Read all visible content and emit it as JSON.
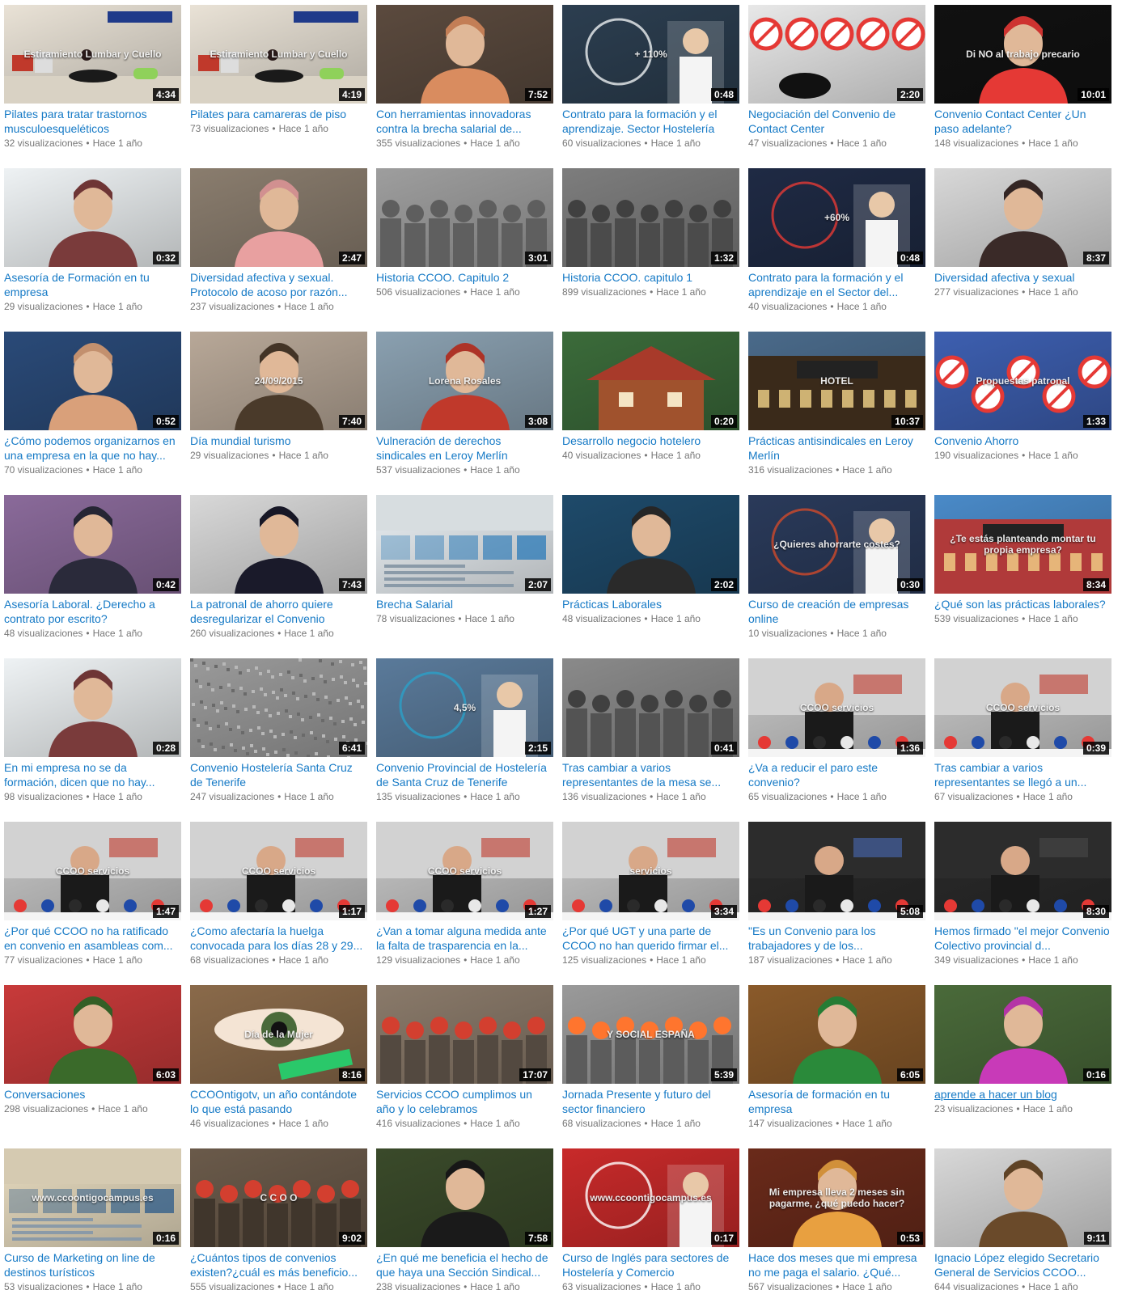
{
  "videos": [
    {
      "title": "Pilates para tratar trastornos musculoesqueléticos",
      "views": "32 visualizaciones",
      "age": "Hace 1 año",
      "duration": "4:34",
      "overlay": "Estiramiento Lumbar y Cuello",
      "bg": "#e9e2d6",
      "accent": "#c0392b",
      "kind": "pilates"
    },
    {
      "title": "Pilates para camareras de piso",
      "views": "73 visualizaciones",
      "age": "Hace 1 año",
      "duration": "4:19",
      "overlay": "Estiramiento Lumbar y Cuello",
      "bg": "#e9e2d6",
      "accent": "#c0392b",
      "kind": "pilates"
    },
    {
      "title": "Con herramientas innovadoras contra la brecha salarial de...",
      "views": "355 visualizaciones",
      "age": "Hace 1 año",
      "duration": "7:52",
      "overlay": "",
      "bg": "#5b4a3e",
      "accent": "#d98c5f",
      "kind": "person"
    },
    {
      "title": "Contrato para la formación y el aprendizaje. Sector Hostelería",
      "views": "60 visualizaciones",
      "age": "Hace 1 año",
      "duration": "0:48",
      "overlay": "+ 110%",
      "bg": "#2c3e50",
      "accent": "#ecf0f1",
      "kind": "badge"
    },
    {
      "title": "Negociación del Convenio de Contact Center",
      "views": "47 visualizaciones",
      "age": "Hace 1 año",
      "duration": "2:20",
      "overlay": "",
      "bg": "#e8e8e8",
      "accent": "#e53935",
      "kind": "signs"
    },
    {
      "title": "Convenio Contact Center ¿Un paso adelante?",
      "views": "148 visualizaciones",
      "age": "Hace 1 año",
      "duration": "10:01",
      "overlay": "Di NO al trabajo precario",
      "bg": "#111111",
      "accent": "#e53935",
      "kind": "person"
    },
    {
      "title": "Asesoría de Formación en tu empresa",
      "views": "29 visualizaciones",
      "age": "Hace 1 año",
      "duration": "0:32",
      "overlay": "",
      "bg": "#eef2f4",
      "accent": "#7a3b3b",
      "kind": "person"
    },
    {
      "title": "Diversidad afectiva y sexual. Protocolo de acoso por razón...",
      "views": "237 visualizaciones",
      "age": "Hace 1 año",
      "duration": "2:47",
      "overlay": "",
      "bg": "#8a7d6e",
      "accent": "#e8a0a0",
      "kind": "person"
    },
    {
      "title": "Historia CCOO. Capitulo 2",
      "views": "506 visualizaciones",
      "age": "Hace 1 año",
      "duration": "3:01",
      "overlay": "",
      "bg": "#9e9e9e",
      "accent": "#555555",
      "kind": "crowd"
    },
    {
      "title": "Historia CCOO. capitulo 1",
      "views": "899 visualizaciones",
      "age": "Hace 1 año",
      "duration": "1:32",
      "overlay": "",
      "bg": "#7d7d7d",
      "accent": "#3a3a3a",
      "kind": "crowd"
    },
    {
      "title": "Contrato para la formación y el aprendizaje en el Sector del...",
      "views": "40 visualizaciones",
      "age": "Hace 1 año",
      "duration": "0:48",
      "overlay": "+60%",
      "bg": "#1f2a44",
      "accent": "#e53935",
      "kind": "badge"
    },
    {
      "title": "Diversidad afectiva y sexual",
      "views": "277 visualizaciones",
      "age": "Hace 1 año",
      "duration": "8:37",
      "overlay": "",
      "bg": "#d8d8d8",
      "accent": "#3a2a28",
      "kind": "person"
    },
    {
      "title": "¿Cómo podemos organizarnos en una empresa en la que no hay...",
      "views": "70 visualizaciones",
      "age": "Hace 1 año",
      "duration": "0:52",
      "overlay": "",
      "bg": "#2a4a78",
      "accent": "#d9a07a",
      "kind": "person"
    },
    {
      "title": "Día mundial turismo",
      "views": "29 visualizaciones",
      "age": "Hace 1 año",
      "duration": "7:40",
      "overlay": "24/09/2015",
      "bg": "#b8a898",
      "accent": "#4a3a2a",
      "kind": "person"
    },
    {
      "title": "Vulneración de derechos sindicales en Leroy Merlín",
      "views": "537 visualizaciones",
      "age": "Hace 1 año",
      "duration": "3:08",
      "overlay": "Lorena Rosales",
      "bg": "#8aa0b0",
      "accent": "#c0392b",
      "kind": "person"
    },
    {
      "title": "Desarrollo negocio hotelero",
      "views": "40 visualizaciones",
      "age": "Hace 1 año",
      "duration": "0:20",
      "overlay": "",
      "bg": "#3b6b3a",
      "accent": "#a0522d",
      "kind": "house"
    },
    {
      "title": "Prácticas antisindicales en Leroy Merlín",
      "views": "316 visualizaciones",
      "age": "Hace 1 año",
      "duration": "10:37",
      "overlay": "HOTEL",
      "bg": "#4a6a8a",
      "accent": "#3a2a1a",
      "kind": "hotel"
    },
    {
      "title": "Convenio Ahorro",
      "views": "190 visualizaciones",
      "age": "Hace 1 año",
      "duration": "1:33",
      "overlay": "Propuestas patronal",
      "bg": "#3d5fb0",
      "accent": "#e53935",
      "kind": "signs"
    },
    {
      "title": "Asesoría Laboral. ¿Derecho a contrato por escrito?",
      "views": "48 visualizaciones",
      "age": "Hace 1 año",
      "duration": "0:42",
      "overlay": "",
      "bg": "#8a6a9a",
      "accent": "#2a2a3a",
      "kind": "person"
    },
    {
      "title": "La patronal de ahorro quiere desregularizar el Convenio",
      "views": "260 visualizaciones",
      "age": "Hace 1 año",
      "duration": "7:43",
      "overlay": "",
      "bg": "#d8d8d8",
      "accent": "#1a1a2a",
      "kind": "person"
    },
    {
      "title": "Brecha Salarial",
      "views": "78 visualizaciones",
      "age": "Hace 1 año",
      "duration": "2:07",
      "overlay": "",
      "bg": "#eaf0f4",
      "accent": "#2a7ab8",
      "kind": "web"
    },
    {
      "title": "Prácticas Laborales",
      "views": "48 visualizaciones",
      "age": "Hace 1 año",
      "duration": "2:02",
      "overlay": "",
      "bg": "#1e4a6a",
      "accent": "#2a2a2a",
      "kind": "person"
    },
    {
      "title": "Curso de creación de empresas online",
      "views": "10 visualizaciones",
      "age": "Hace 1 año",
      "duration": "0:30",
      "overlay": "¿Quieres ahorrarte costes?",
      "bg": "#2a3a5a",
      "accent": "#d04a2a",
      "kind": "badge"
    },
    {
      "title": "¿Qué son las prácticas laborales?",
      "views": "539 visualizaciones",
      "age": "Hace 1 año",
      "duration": "8:34",
      "overlay": "¿Te estás planteando montar tu propia empresa?",
      "bg": "#4a8ac8",
      "accent": "#b03a3a",
      "kind": "hotel"
    },
    {
      "title": "En mi empresa no se da formación, dicen que no hay...",
      "views": "98 visualizaciones",
      "age": "Hace 1 año",
      "duration": "0:28",
      "overlay": "",
      "bg": "#eef2f4",
      "accent": "#7a3b3b",
      "kind": "person"
    },
    {
      "title": "Convenio Hostelería Santa Cruz de Tenerife",
      "views": "247 visualizaciones",
      "age": "Hace 1 año",
      "duration": "6:41",
      "overlay": "",
      "bg": "#9a9a9a",
      "accent": "#7a7a7a",
      "kind": "noise"
    },
    {
      "title": "Convenio Provincial de Hostelería de Santa Cruz de Tenerife",
      "views": "135 visualizaciones",
      "age": "Hace 1 año",
      "duration": "2:15",
      "overlay": "4,5%",
      "bg": "#5a7a9a",
      "accent": "#2aa0c8",
      "kind": "badge"
    },
    {
      "title": "Tras cambiar a varios representantes de la mesa se...",
      "views": "136 visualizaciones",
      "age": "Hace 1 año",
      "duration": "0:41",
      "overlay": "",
      "bg": "#8a8a8a",
      "accent": "#3a3a3a",
      "kind": "crowd"
    },
    {
      "title": "¿Va a reducir el paro este convenio?",
      "views": "65 visualizaciones",
      "age": "Hace 1 año",
      "duration": "1:36",
      "overlay": "CCOO servicios",
      "bg": "#c8c8c8",
      "accent": "#c0392b",
      "kind": "press"
    },
    {
      "title": "Tras cambiar a varios representantes se llegó a un...",
      "views": "67 visualizaciones",
      "age": "Hace 1 año",
      "duration": "0:39",
      "overlay": "CCOO servicios",
      "bg": "#c8c8c8",
      "accent": "#c0392b",
      "kind": "press"
    },
    {
      "title": "¿Por qué CCOO no ha ratificado en convenio en asambleas com...",
      "views": "77 visualizaciones",
      "age": "Hace 1 año",
      "duration": "1:47",
      "overlay": "CCOO servicios",
      "bg": "#c8c8c8",
      "accent": "#c0392b",
      "kind": "press"
    },
    {
      "title": "¿Como afectaría la huelga convocada para los días 28 y 29...",
      "views": "68 visualizaciones",
      "age": "Hace 1 año",
      "duration": "1:17",
      "overlay": "CCOO servicios",
      "bg": "#c8c8c8",
      "accent": "#c0392b",
      "kind": "press"
    },
    {
      "title": "¿Van a tomar alguna medida ante la falta de trasparencia en la...",
      "views": "129 visualizaciones",
      "age": "Hace 1 año",
      "duration": "1:27",
      "overlay": "CCOO servicios",
      "bg": "#c8c8c8",
      "accent": "#c0392b",
      "kind": "press"
    },
    {
      "title": "¿Por qué UGT y una parte de CCOO no han querido firmar el...",
      "views": "125 visualizaciones",
      "age": "Hace 1 año",
      "duration": "3:34",
      "overlay": "servicios",
      "bg": "#c8c8c8",
      "accent": "#c0392b",
      "kind": "press"
    },
    {
      "title": "\"Es un Convenio para los trabajadores y de los...",
      "views": "187 visualizaciones",
      "age": "Hace 1 año",
      "duration": "5:08",
      "overlay": "",
      "bg": "#2a2a2a",
      "accent": "#4a6ab8",
      "kind": "press"
    },
    {
      "title": "Hemos firmado \"el mejor Convenio Colectivo provincial d...",
      "views": "349 visualizaciones",
      "age": "Hace 1 año",
      "duration": "8:30",
      "overlay": "",
      "bg": "#2a2a2a",
      "accent": "#4a4a4a",
      "kind": "press"
    },
    {
      "title": "Conversaciones",
      "views": "298 visualizaciones",
      "age": "Hace 1 año",
      "duration": "6:03",
      "overlay": "",
      "bg": "#c83a3a",
      "accent": "#3a6a2a",
      "kind": "person"
    },
    {
      "title": "CCOOntigotv, un año contándote lo que está pasando",
      "views": "46 visualizaciones",
      "age": "Hace 1 año",
      "duration": "8:16",
      "overlay": "Día de la Mujer",
      "bg": "#8a6a4a",
      "accent": "#2ac86a",
      "kind": "eye"
    },
    {
      "title": "Servicios CCOO cumplimos un año y lo celebramos",
      "views": "416 visualizaciones",
      "age": "Hace 1 año",
      "duration": "17:07",
      "overlay": "",
      "bg": "#8a7a6a",
      "accent": "#c0392b",
      "kind": "crowd"
    },
    {
      "title": "Jornada Presente y futuro del sector financiero",
      "views": "68 visualizaciones",
      "age": "Hace 1 año",
      "duration": "5:39",
      "overlay": "Y SOCIAL ESPAÑA",
      "bg": "#9a9a9a",
      "accent": "#e86a2a",
      "kind": "crowd"
    },
    {
      "title": "Asesoría de formación en tu empresa",
      "views": "147 visualizaciones",
      "age": "Hace 1 año",
      "duration": "6:05",
      "overlay": "",
      "bg": "#8a5a2a",
      "accent": "#2a8a3a",
      "kind": "person"
    },
    {
      "title": "aprende a hacer un blog",
      "views": "23 visualizaciones",
      "age": "Hace 1 año",
      "duration": "0:16",
      "overlay": "",
      "bg": "#4a6a3a",
      "accent": "#c83ab8",
      "kind": "person",
      "underline": true
    },
    {
      "title": "Curso de Marketing on line de destinos turísticos",
      "views": "53 visualizaciones",
      "age": "Hace 1 año",
      "duration": "0:16",
      "overlay": "www.ccoontigocampus.es",
      "bg": "#e8dcc0",
      "accent": "#2a5a8a",
      "kind": "web"
    },
    {
      "title": "¿Cuántos tipos de convenios existen?¿cuál es más beneficio...",
      "views": "555 visualizaciones",
      "age": "Hace 1 año",
      "duration": "9:02",
      "overlay": "C C O O",
      "bg": "#6a5a4a",
      "accent": "#c0392b",
      "kind": "crowd"
    },
    {
      "title": "¿En qué me beneficia el hecho de que haya una Sección Sindical...",
      "views": "238 visualizaciones",
      "age": "Hace 1 año",
      "duration": "7:58",
      "overlay": "",
      "bg": "#3a4a2a",
      "accent": "#1a1a1a",
      "kind": "person"
    },
    {
      "title": "Curso de Inglés para sectores de Hostelería y Comercio",
      "views": "63 visualizaciones",
      "age": "Hace 1 año",
      "duration": "0:17",
      "overlay": "www.ccoontigocampus.es",
      "bg": "#c82a2a",
      "accent": "#ffffff",
      "kind": "badge"
    },
    {
      "title": "Hace dos meses que mi empresa no me paga el salario. ¿Qué...",
      "views": "567 visualizaciones",
      "age": "Hace 1 año",
      "duration": "0:53",
      "overlay": "Mi empresa lleva 2 meses sin pagarme, ¿qué puedo hacer?",
      "bg": "#6a2a1a",
      "accent": "#e8a040",
      "kind": "person"
    },
    {
      "title": "Ignacio López elegido Secretario General de Servicios CCOO...",
      "views": "644 visualizaciones",
      "age": "Hace 1 año",
      "duration": "9:11",
      "overlay": "",
      "bg": "#d8d8d8",
      "accent": "#6a4a2a",
      "kind": "person"
    }
  ]
}
